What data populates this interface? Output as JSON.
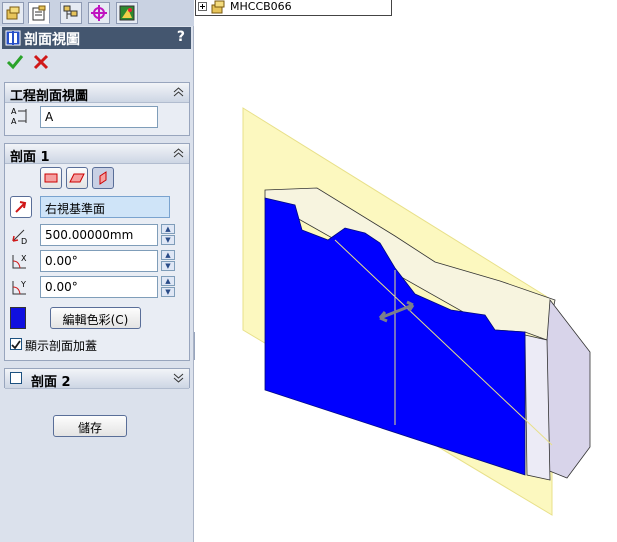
{
  "panel": {
    "title": "剖面視圖",
    "help": "?",
    "group1": {
      "label": "工程剖面視圖",
      "label_value": "A"
    },
    "group2": {
      "label": "剖面 1",
      "plane_value": "右視基準面",
      "distance_value": "500.00000mm",
      "angle_x_value": "0.00°",
      "angle_y_value": "0.00°",
      "edit_color_label": "編輯色彩(C)",
      "show_cap_label": "顯示剖面加蓋",
      "show_cap_checked": true,
      "swatch_color": "#1010e0"
    },
    "group3": {
      "label": "剖面 2",
      "checked": false
    },
    "save_label": "儲存"
  },
  "tree": {
    "item_label": "MHCCB066"
  },
  "model": {
    "section_color": "#0000ff",
    "plane_color": "#fbf7b4"
  }
}
